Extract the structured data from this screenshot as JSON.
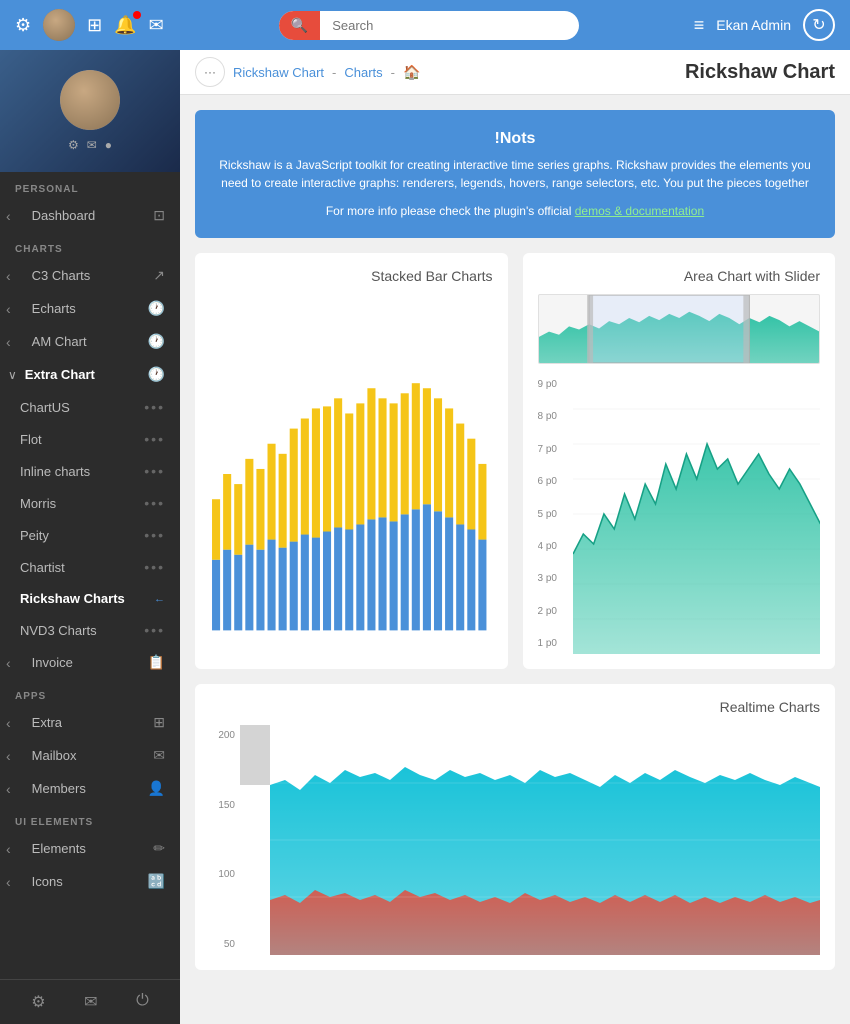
{
  "topnav": {
    "search_placeholder": "Search",
    "username": "Ekan Admin"
  },
  "breadcrumb": {
    "rickshaw_label": "Rickshaw Chart",
    "separator": "-",
    "charts_label": "Charts",
    "page_title": "Rickshaw Chart"
  },
  "infobox": {
    "title": "!Nots",
    "description": "Rickshaw is a JavaScript toolkit for creating interactive time series graphs. Rickshaw provides the elements you need to create interactive graphs: renderers, legends, hovers, range selectors, etc. You put the pieces together",
    "link_text": "For more info please check the plugin's official",
    "link_label": "demos & documentation"
  },
  "charts": {
    "stacked_title": "Stacked Bar Charts",
    "area_title": "Area Chart with Slider",
    "realtime_title": "Realtime Charts",
    "area_yaxis": [
      "9 p0",
      "8 p0",
      "7 p0",
      "6 p0",
      "5 p0",
      "4 p0",
      "3 p0",
      "2 p0",
      "1 p0"
    ],
    "realtime_yaxis": [
      "200",
      "150",
      "100",
      "50"
    ]
  },
  "sidebar": {
    "personal_label": "PERSONAL",
    "charts_label": "CHARTS",
    "apps_label": "APPS",
    "ui_elements_label": "UI ELEMENTS",
    "items": {
      "dashboard": "Dashboard",
      "c3charts": "C3 Charts",
      "echarts": "Echarts",
      "amchart": "AM Chart",
      "extrachart": "Extra Chart",
      "chartus": "ChartUS",
      "flot": "Flot",
      "inlinecharts": "Inline charts",
      "morris": "Morris",
      "peity": "Peity",
      "chartist": "Chartist",
      "rickshaw": "Rickshaw Charts",
      "nvd3": "NVD3 Charts",
      "invoice": "Invoice",
      "extra": "Extra",
      "mailbox": "Mailbox",
      "members": "Members",
      "elements": "Elements",
      "icons": "Icons"
    }
  }
}
